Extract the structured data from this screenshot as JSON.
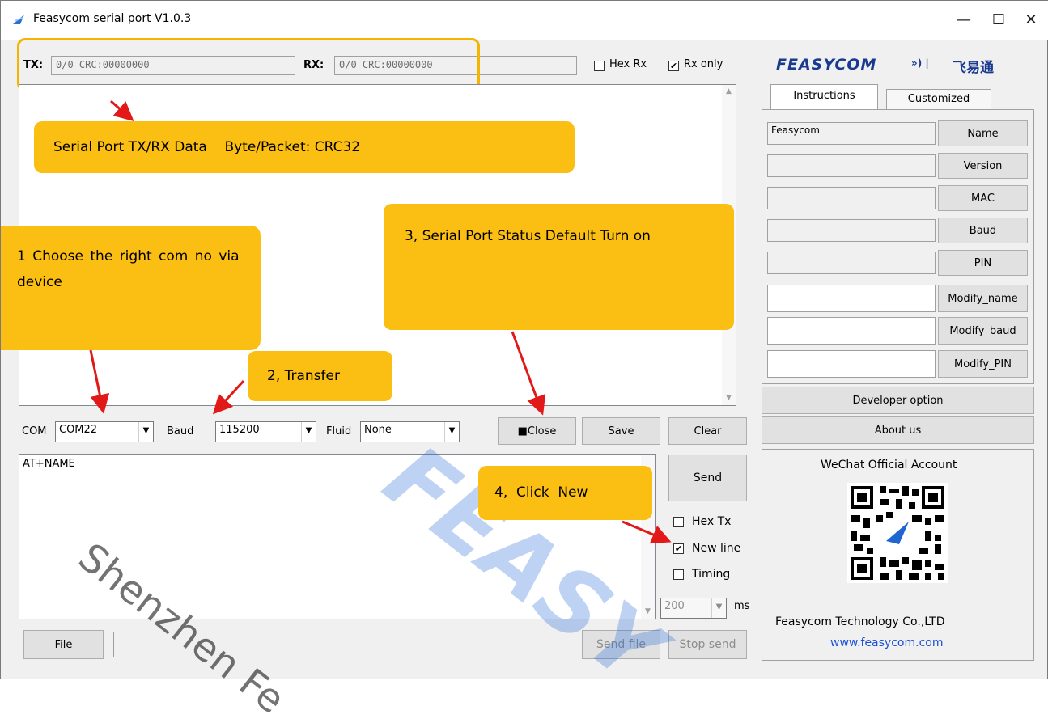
{
  "window": {
    "title": "Feasycom serial port V1.0.3",
    "minimize": "—",
    "maximize": "☐",
    "close": "✕"
  },
  "status": {
    "tx_label": "TX:",
    "tx_value": "0/0 CRC:00000000",
    "rx_label": "RX:",
    "rx_value": "0/0 CRC:00000000",
    "hex_rx_label": "Hex Rx",
    "hex_rx_checked": false,
    "rx_only_label": "Rx only",
    "rx_only_checked": true
  },
  "brand": {
    "logo": "FEASYCOM",
    "chinese": "飞易通"
  },
  "tabs": [
    {
      "label": "Instructions",
      "active": true
    },
    {
      "label": "Customized",
      "active": false
    }
  ],
  "instructions": [
    {
      "value": "Feasycom",
      "button": "Name"
    },
    {
      "value": "",
      "button": "Version"
    },
    {
      "value": "",
      "button": "MAC"
    },
    {
      "value": "",
      "button": "Baud"
    },
    {
      "value": "",
      "button": "PIN"
    },
    {
      "value": "",
      "button": "Modify_name"
    },
    {
      "value": "",
      "button": "Modify_baud"
    },
    {
      "value": "",
      "button": "Modify_PIN"
    }
  ],
  "developer_option": "Developer option",
  "about_us": "About us",
  "wechat": {
    "heading": "WeChat Official Account",
    "company": "Feasycom Technology Co.,LTD",
    "url": "www.feasycom.com"
  },
  "port": {
    "com_label": "COM",
    "com_value": "COM22",
    "baud_label": "Baud",
    "baud_value": "115200",
    "fluid_label": "Fluid",
    "fluid_value": "None"
  },
  "buttons": {
    "close": "■Close",
    "save": "Save",
    "clear": "Clear",
    "send": "Send",
    "file": "File",
    "send_file": "Send file",
    "stop_send": "Stop send"
  },
  "send_area": {
    "text": "AT+NAME"
  },
  "options": {
    "hex_tx_label": "Hex Tx",
    "hex_tx_checked": false,
    "new_line_label": "New line",
    "new_line_checked": true,
    "timing_label": "Timing",
    "timing_checked": false,
    "interval_value": "200",
    "interval_unit": "ms"
  },
  "callouts": {
    "c0": "Serial Port TX/RX Data    Byte/Packet: CRC32",
    "c1": "1 Choose the right com no via device",
    "c2": "2, Transfer",
    "c3": "3, Serial Port Status Default Turn on",
    "c4": "4,  Click  New"
  },
  "watermark": {
    "text1": "Shenzhen Fe",
    "text2": "FEASY"
  },
  "colors": {
    "callout": "#fbbe12",
    "arrow": "#e11919",
    "brand_blue": "#1a3a8f",
    "link_blue": "#1a4fd6",
    "highlight_box": "#f5b400"
  }
}
